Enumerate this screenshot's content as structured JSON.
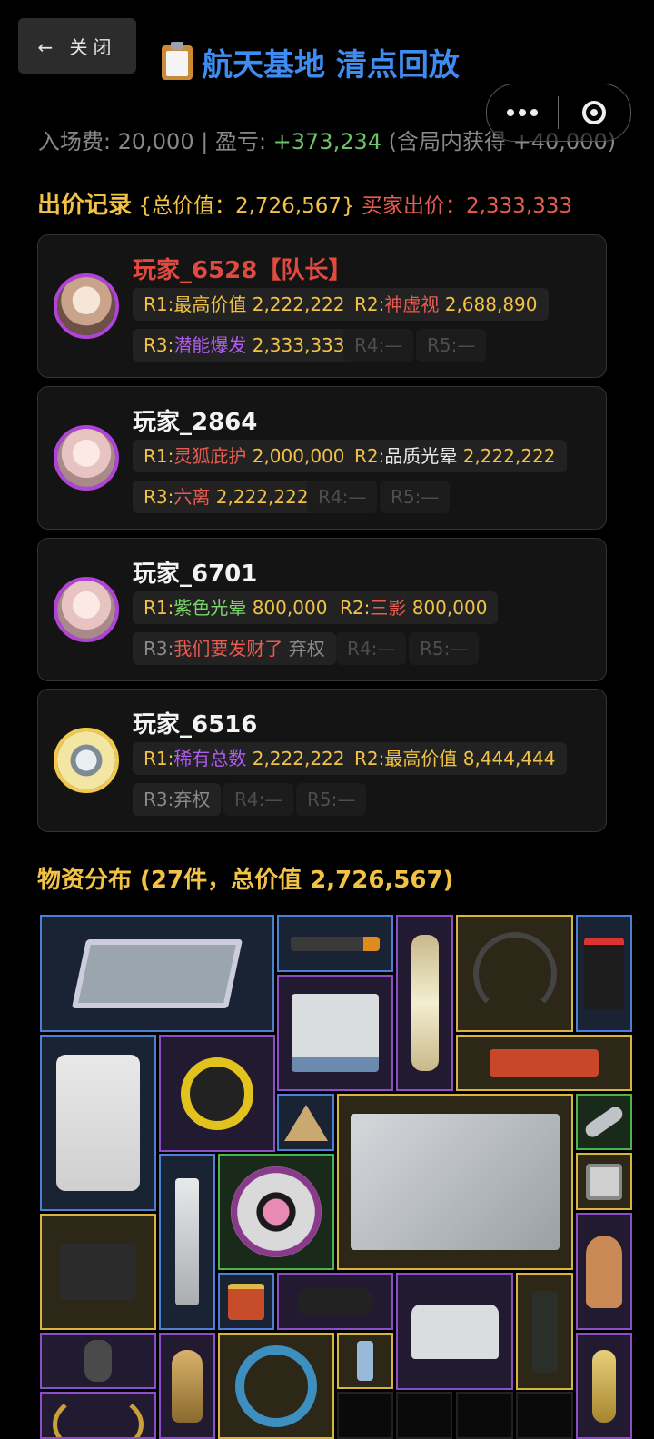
{
  "header": {
    "close_label": "← 关闭",
    "title": "航天基地 清点回放",
    "title_icon": "clipboard-icon"
  },
  "capsule": {
    "more_icon": "more-dots-icon",
    "close_icon": "target-circle-icon"
  },
  "summary": {
    "prefix": "入场费: 20,000 | 盈亏: ",
    "profit": "+373,234",
    "suffix": " (含局内获得 +40,000)"
  },
  "bids": {
    "heading": "出价记录",
    "total": " {总价值：2,726,567} ",
    "buyer": "买家出价：2,333,333",
    "players": [
      {
        "name": "玩家_6528【队长】",
        "rounds": [
          {
            "r": "R1:",
            "skill": "最高价值",
            "amount": " 2,222,222"
          },
          {
            "r": "R2:",
            "skill": "神虚视",
            "amount": " 2,688,890"
          },
          {
            "r": "R3:",
            "skill": "潜能爆发",
            "amount": " 2,333,333"
          },
          {
            "r": "R4:",
            "skill": "",
            "amount": "—"
          },
          {
            "r": "R5:",
            "skill": "",
            "amount": "—"
          }
        ]
      },
      {
        "name": "玩家_2864",
        "rounds": [
          {
            "r": "R1:",
            "skill": "灵狐庇护",
            "amount": " 2,000,000"
          },
          {
            "r": "R2:",
            "skill": "品质光晕",
            "amount": " 2,222,222"
          },
          {
            "r": "R3:",
            "skill": "六离",
            "amount": " 2,222,222"
          },
          {
            "r": "R4:",
            "skill": "",
            "amount": "—"
          },
          {
            "r": "R5:",
            "skill": "",
            "amount": "—"
          }
        ]
      },
      {
        "name": "玩家_6701",
        "rounds": [
          {
            "r": "R1:",
            "skill": "紫色光晕",
            "amount": " 800,000"
          },
          {
            "r": "R2:",
            "skill": "三影",
            "amount": " 800,000"
          },
          {
            "r": "R3:",
            "skill": "我们要发财了",
            "amount": " 弃权"
          },
          {
            "r": "R4:",
            "skill": "",
            "amount": "—"
          },
          {
            "r": "R5:",
            "skill": "",
            "amount": "—"
          }
        ]
      },
      {
        "name": "玩家_6516",
        "rounds": [
          {
            "r": "R1:",
            "skill": "稀有总数",
            "amount": " 2,222,222"
          },
          {
            "r": "R2:",
            "skill": "最高价值",
            "amount": " 8,444,444"
          },
          {
            "r": "R3:",
            "skill": "",
            "amount": "弃权"
          },
          {
            "r": "R4:",
            "skill": "",
            "amount": "—"
          },
          {
            "r": "R5:",
            "skill": "",
            "amount": "—"
          }
        ]
      }
    ]
  },
  "items": {
    "heading": "物资分布 (27件，总价值 2,726,567)",
    "legend_colors": {
      "blue": "#4d7fd6",
      "purple": "#8a4fc7",
      "gold": "#d9b43c",
      "green": "#4db34d"
    }
  }
}
